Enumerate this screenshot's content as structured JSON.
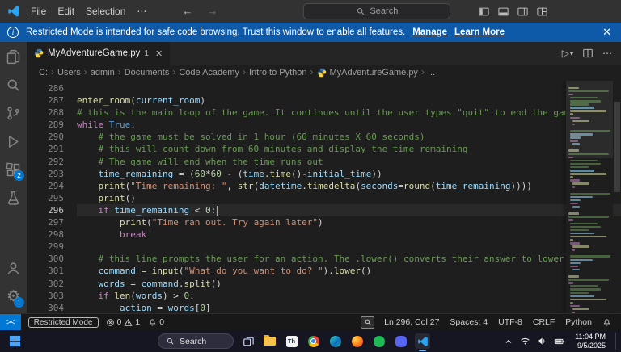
{
  "colors": {
    "accent": "#0078d4",
    "banner_bg": "#0e5aa8",
    "kw": "#c586c0",
    "fn": "#dcdcaa",
    "var": "#9cdcfe",
    "str": "#ce9178",
    "num": "#b5cea8",
    "cmt": "#6a9955",
    "pun": "#d4d4d4",
    "const": "#569cd6",
    "param": "#9cdcfe"
  },
  "title_bar": {
    "menus": [
      "File",
      "Edit",
      "Selection",
      "⋯"
    ],
    "search_label": "Search"
  },
  "banner": {
    "message": "Restricted Mode is intended for safe code browsing. Trust this window to enable all features.",
    "manage_label": "Manage",
    "learn_more_label": "Learn More"
  },
  "activity_bar": {
    "extensions_badge": "2",
    "settings_badge": "1"
  },
  "tab": {
    "label": "MyAdventureGame.py",
    "badge": "1"
  },
  "editor_actions": {
    "run_label": "▷",
    "run_caret": "▾",
    "more_label": "⋯"
  },
  "breadcrumb": {
    "items": [
      "C:",
      "Users",
      "admin",
      "Documents",
      "Code Academy",
      "Intro to Python",
      "MyAdventureGame.py",
      "..."
    ]
  },
  "editor": {
    "current_line": 296,
    "lines": [
      {
        "num": 286,
        "tokens": []
      },
      {
        "num": 287,
        "tokens": [
          {
            "t": "enter_room",
            "c": "fn"
          },
          {
            "t": "(",
            "c": "pun"
          },
          {
            "t": "current_room",
            "c": "var"
          },
          {
            "t": ")",
            "c": "pun"
          }
        ]
      },
      {
        "num": 288,
        "tokens": [
          {
            "t": "# this is the main loop of the game. It continues until the user types \"quit\" to end the game",
            "c": "cmt"
          }
        ]
      },
      {
        "num": 289,
        "tokens": [
          {
            "t": "while",
            "c": "kw"
          },
          {
            "t": " ",
            "c": "pun"
          },
          {
            "t": "True",
            "c": "const"
          },
          {
            "t": ":",
            "c": "pun"
          }
        ]
      },
      {
        "num": 290,
        "tokens": [
          {
            "t": "    # the game must be solved in 1 hour (60 minutes X 60 seconds)",
            "c": "cmt"
          }
        ]
      },
      {
        "num": 291,
        "tokens": [
          {
            "t": "    # this will count down from 60 minutes and display the time remaining",
            "c": "cmt"
          }
        ]
      },
      {
        "num": 292,
        "tokens": [
          {
            "t": "    # The game will end when the time runs out",
            "c": "cmt"
          }
        ]
      },
      {
        "num": 293,
        "tokens": [
          {
            "t": "    ",
            "c": "pun"
          },
          {
            "t": "time_remaining",
            "c": "var"
          },
          {
            "t": " = (",
            "c": "pun"
          },
          {
            "t": "60",
            "c": "num"
          },
          {
            "t": "*",
            "c": "pun"
          },
          {
            "t": "60",
            "c": "num"
          },
          {
            "t": " - (",
            "c": "pun"
          },
          {
            "t": "time",
            "c": "var"
          },
          {
            "t": ".",
            "c": "pun"
          },
          {
            "t": "time",
            "c": "fn"
          },
          {
            "t": "()-",
            "c": "pun"
          },
          {
            "t": "initial_time",
            "c": "var"
          },
          {
            "t": "))",
            "c": "pun"
          }
        ]
      },
      {
        "num": 294,
        "tokens": [
          {
            "t": "    ",
            "c": "pun"
          },
          {
            "t": "print",
            "c": "fn"
          },
          {
            "t": "(",
            "c": "pun"
          },
          {
            "t": "\"Time remaining: \"",
            "c": "str"
          },
          {
            "t": ", ",
            "c": "pun"
          },
          {
            "t": "str",
            "c": "fn"
          },
          {
            "t": "(",
            "c": "pun"
          },
          {
            "t": "datetime",
            "c": "var"
          },
          {
            "t": ".",
            "c": "pun"
          },
          {
            "t": "timedelta",
            "c": "fn"
          },
          {
            "t": "(",
            "c": "pun"
          },
          {
            "t": "seconds",
            "c": "param"
          },
          {
            "t": "=",
            "c": "pun"
          },
          {
            "t": "round",
            "c": "fn"
          },
          {
            "t": "(",
            "c": "pun"
          },
          {
            "t": "time_remaining",
            "c": "var"
          },
          {
            "t": "))))",
            "c": "pun"
          }
        ]
      },
      {
        "num": 295,
        "tokens": [
          {
            "t": "    ",
            "c": "pun"
          },
          {
            "t": "print",
            "c": "fn"
          },
          {
            "t": "()",
            "c": "pun"
          }
        ]
      },
      {
        "num": 296,
        "tokens": [
          {
            "t": "    ",
            "c": "pun"
          },
          {
            "t": "if",
            "c": "kw"
          },
          {
            "t": " ",
            "c": "pun"
          },
          {
            "t": "time_remaining",
            "c": "var"
          },
          {
            "t": " < ",
            "c": "pun"
          },
          {
            "t": "0",
            "c": "num"
          },
          {
            "t": ":",
            "c": "pun"
          }
        ]
      },
      {
        "num": 297,
        "tokens": [
          {
            "t": "        ",
            "c": "pun"
          },
          {
            "t": "print",
            "c": "fn"
          },
          {
            "t": "(",
            "c": "pun"
          },
          {
            "t": "\"Time ran out. Try again later\"",
            "c": "str"
          },
          {
            "t": ")",
            "c": "pun"
          }
        ]
      },
      {
        "num": 298,
        "tokens": [
          {
            "t": "        ",
            "c": "pun"
          },
          {
            "t": "break",
            "c": "kw"
          }
        ]
      },
      {
        "num": 299,
        "tokens": []
      },
      {
        "num": 300,
        "tokens": [
          {
            "t": "    # this line prompts the user for an action. The .lower() converts their answer to lower case",
            "c": "cmt"
          }
        ]
      },
      {
        "num": 301,
        "tokens": [
          {
            "t": "    ",
            "c": "pun"
          },
          {
            "t": "command",
            "c": "var"
          },
          {
            "t": " = ",
            "c": "pun"
          },
          {
            "t": "input",
            "c": "fn"
          },
          {
            "t": "(",
            "c": "pun"
          },
          {
            "t": "\"What do you want to do? \"",
            "c": "str"
          },
          {
            "t": ").",
            "c": "pun"
          },
          {
            "t": "lower",
            "c": "fn"
          },
          {
            "t": "()",
            "c": "pun"
          }
        ]
      },
      {
        "num": 302,
        "tokens": [
          {
            "t": "    ",
            "c": "pun"
          },
          {
            "t": "words",
            "c": "var"
          },
          {
            "t": " = ",
            "c": "pun"
          },
          {
            "t": "command",
            "c": "var"
          },
          {
            "t": ".",
            "c": "pun"
          },
          {
            "t": "split",
            "c": "fn"
          },
          {
            "t": "()",
            "c": "pun"
          }
        ]
      },
      {
        "num": 303,
        "tokens": [
          {
            "t": "    ",
            "c": "pun"
          },
          {
            "t": "if",
            "c": "kw"
          },
          {
            "t": " ",
            "c": "pun"
          },
          {
            "t": "len",
            "c": "fn"
          },
          {
            "t": "(",
            "c": "pun"
          },
          {
            "t": "words",
            "c": "var"
          },
          {
            "t": ") > ",
            "c": "pun"
          },
          {
            "t": "0",
            "c": "num"
          },
          {
            "t": ":",
            "c": "pun"
          }
        ]
      },
      {
        "num": 304,
        "tokens": [
          {
            "t": "        ",
            "c": "pun"
          },
          {
            "t": "action",
            "c": "var"
          },
          {
            "t": " = ",
            "c": "pun"
          },
          {
            "t": "words",
            "c": "var"
          },
          {
            "t": "[",
            "c": "pun"
          },
          {
            "t": "0",
            "c": "num"
          },
          {
            "t": "]",
            "c": "pun"
          }
        ]
      }
    ]
  },
  "status_bar": {
    "restricted_label": "Restricted Mode",
    "errors": "0",
    "warnings": "1",
    "bell_count": "0",
    "cursor": "Ln 296, Col 27",
    "indent": "Spaces: 4",
    "encoding": "UTF-8",
    "eol": "CRLF",
    "language": "Python"
  },
  "taskbar": {
    "search_label": "Search",
    "time": "11:04 PM",
    "date": "9/5/2025"
  }
}
